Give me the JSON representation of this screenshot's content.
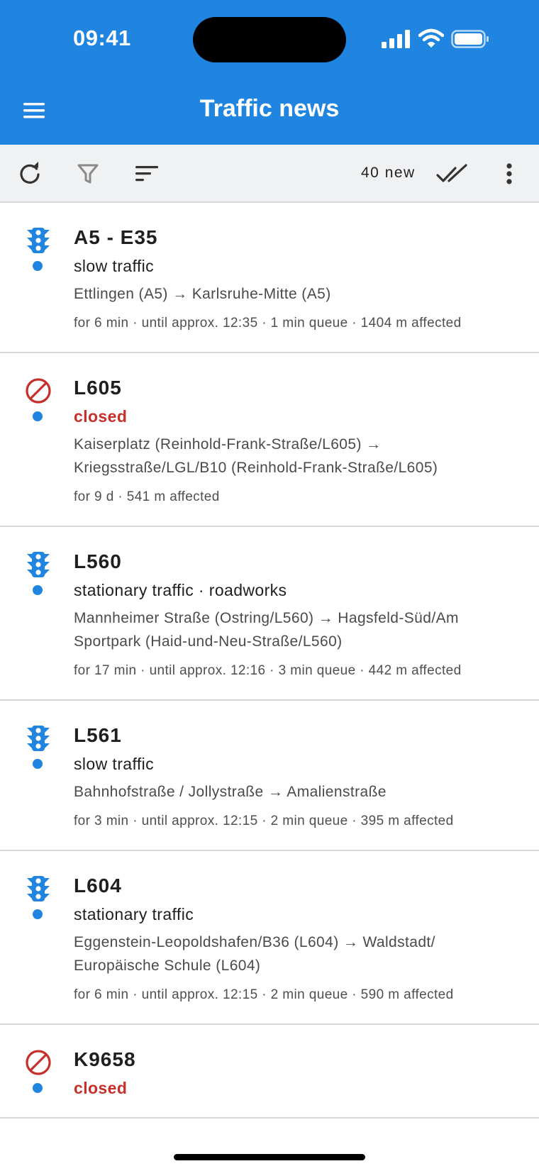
{
  "status": {
    "time": "09:41"
  },
  "header": {
    "title": "Traffic news"
  },
  "toolbar": {
    "new_count": "40 new"
  },
  "colors": {
    "primary": "#1f85e0",
    "closed": "#c7302a",
    "toolbar_bg": "#f0f1f3"
  },
  "items": [
    {
      "icon": "traffic-light-icon",
      "road": "A5 - E35",
      "type": "slow traffic",
      "route": "Ettlingen (A5) → Karlsruhe-Mitte (A5)",
      "meta": "for 6 min  ·  until approx. 12:35  ·  1 min queue  ·  1404 m affected"
    },
    {
      "icon": "no-entry-icon",
      "road": "L605",
      "type": "closed",
      "route": "Kaiserplatz (Reinhold-Frank-Straße/L605) → Kriegsstraße/LGL/B10 (Reinhold-Frank-Straße/L605)",
      "meta": "for 9 d  ·  541 m affected"
    },
    {
      "icon": "traffic-light-icon",
      "road": "L560",
      "type": "stationary traffic · roadworks",
      "route": "Mannheimer Straße (Ostring/L560) → Hagsfeld-Süd/Am Sportpark (Haid-und-Neu-Straße/L560)",
      "meta": "for 17 min  ·  until approx. 12:16  ·  3 min queue  ·  442 m affected"
    },
    {
      "icon": "traffic-light-icon",
      "road": "L561",
      "type": "slow traffic",
      "route": "Bahnhofstraße / Jollystraße → Amalienstraße",
      "meta": "for 3 min  ·  until approx. 12:15  ·  2 min queue  ·  395 m affected"
    },
    {
      "icon": "traffic-light-icon",
      "road": "L604",
      "type": "stationary traffic",
      "route": "Eggenstein-Leopoldshafen/B36 (L604) → Waldstadt/ Europäische Schule (L604)",
      "meta": "for 6 min  ·  until approx. 12:15  ·  2 min queue  ·  590 m affected"
    },
    {
      "icon": "no-entry-icon",
      "road": "K9658",
      "type": "closed",
      "route": "",
      "meta": ""
    }
  ]
}
